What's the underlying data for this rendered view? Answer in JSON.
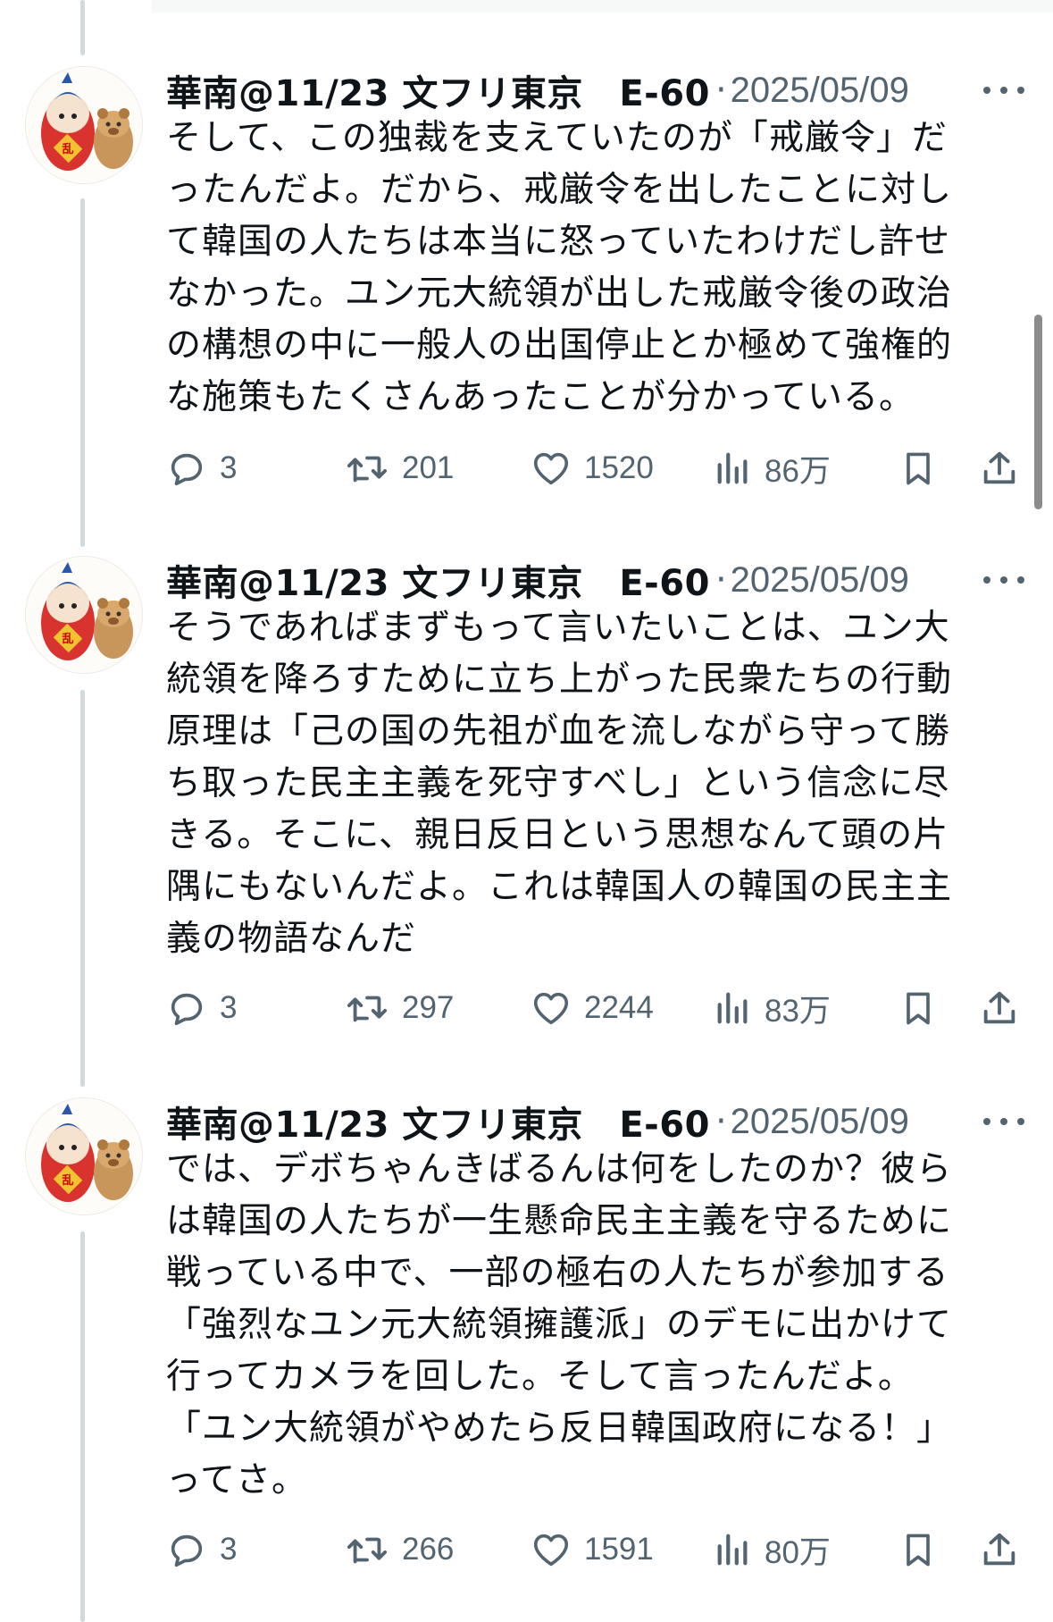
{
  "tweets": [
    {
      "author": "華南@11/23 文フリ東京　E-60",
      "separator": "·",
      "date": "2025/05/09",
      "text": "そして、この独裁を支えていたのが「戒厳令」だ\nったんだよ。だから、戒厳令を出したことに対し\nて韓国の人たちは本当に怒っていたわけだし許せ\nなかった。ユン元大統領が出した戒厳令後の政治\nの構想の中に一般人の出国停止とか極めて強権的\nな施策もたくさんあったことが分かっている。",
      "replies": "3",
      "retweets": "201",
      "likes": "1520",
      "views": "86万"
    },
    {
      "author": "華南@11/23 文フリ東京　E-60",
      "separator": "·",
      "date": "2025/05/09",
      "text": "そうであればまずもって言いたいことは、ユン大\n統領を降ろすために立ち上がった民衆たちの行動\n原理は「己の国の先祖が血を流しながら守って勝\nち取った民主主義を死守すべし」という信念に尽\nきる。そこに、親日反日という思想なんて頭の片\n隅にもないんだよ。これは韓国人の韓国の民主主\n義の物語なんだ",
      "replies": "3",
      "retweets": "297",
      "likes": "2244",
      "views": "83万"
    },
    {
      "author": "華南@11/23 文フリ東京　E-60",
      "separator": "·",
      "date": "2025/05/09",
      "text": "では、デボちゃんきばるんは何をしたのか？彼ら\nは韓国の人たちが一生懸命民主主義を守るために\n戦っている中で、一部の極右の人たちが参加する\n「強烈なユン元大統領擁護派」のデモに出かけて\n行ってカメラを回した。そして言ったんだよ。\n「ユン大統領がやめたら反日韓国政府になる！」\nってさ。",
      "replies": "3",
      "retweets": "266",
      "likes": "1591",
      "views": "80万"
    }
  ],
  "icons": {
    "reply": "speech-bubble-icon",
    "retweet": "retweet-arrows-icon",
    "like": "heart-icon",
    "views": "bar-chart-icon",
    "bookmark": "bookmark-icon",
    "share": "share-upload-icon",
    "more": "more-dots-icon"
  },
  "colors": {
    "text": "#0f1419",
    "secondary": "#536471",
    "thread_line": "#cfd9de",
    "background": "#ffffff"
  }
}
